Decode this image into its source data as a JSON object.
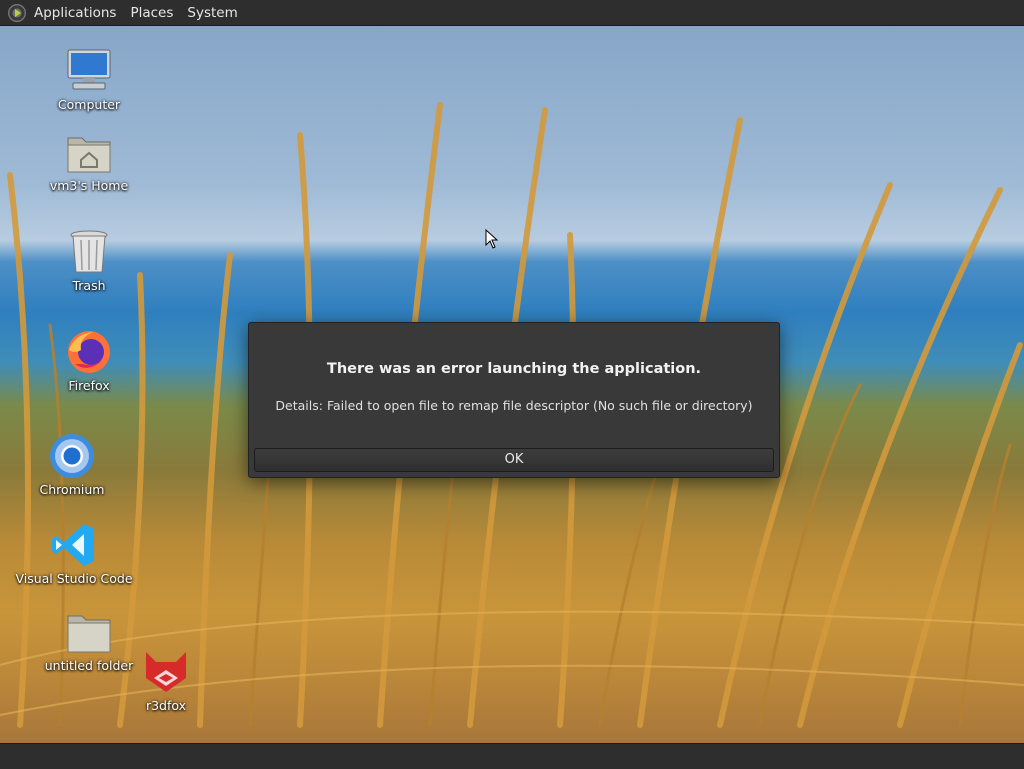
{
  "top_panel": {
    "menus": [
      "Applications",
      "Places",
      "System"
    ]
  },
  "desktop_icons": [
    {
      "label": "Computer",
      "icon": "computer-icon"
    },
    {
      "label": "vm3's Home",
      "icon": "home-folder-icon"
    },
    {
      "label": "Trash",
      "icon": "trash-icon"
    },
    {
      "label": "Firefox",
      "icon": "firefox-icon"
    },
    {
      "label": "Chromium",
      "icon": "chromium-icon"
    },
    {
      "label": "Visual Studio Code",
      "icon": "vscode-icon"
    },
    {
      "label": "untitled folder",
      "icon": "folder-icon"
    },
    {
      "label": "r3dfox",
      "icon": "r3dfox-icon"
    }
  ],
  "dialog": {
    "title": "There was an error launching the application.",
    "detail": "Details: Failed to open file to remap file descriptor (No such file or directory)",
    "ok_label": "OK"
  },
  "colors": {
    "panel": "#2e2e2e",
    "dialog_bg": "#393939"
  }
}
